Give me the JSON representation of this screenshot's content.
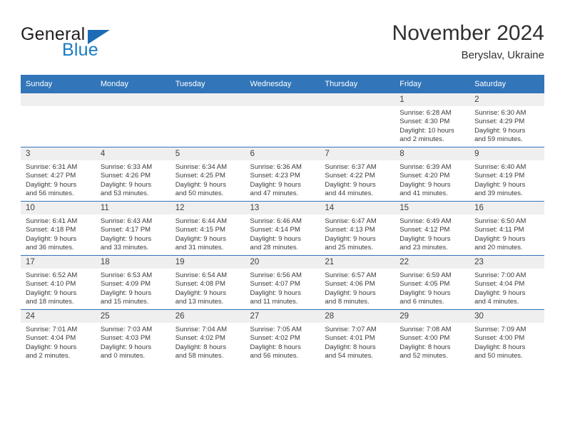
{
  "brand": {
    "name_part1": "General",
    "name_part2": "Blue",
    "logo_icon": "triangle-icon"
  },
  "header": {
    "month_year": "November 2024",
    "location": "Beryslav, Ukraine"
  },
  "calendar": {
    "weekday_headers": [
      "Sunday",
      "Monday",
      "Tuesday",
      "Wednesday",
      "Thursday",
      "Friday",
      "Saturday"
    ],
    "accent_color": "#3275b9",
    "daynum_band_color": "#efefef",
    "weeks": [
      [
        {
          "day": "",
          "empty": true
        },
        {
          "day": "",
          "empty": true
        },
        {
          "day": "",
          "empty": true
        },
        {
          "day": "",
          "empty": true
        },
        {
          "day": "",
          "empty": true
        },
        {
          "day": "1",
          "sunrise": "Sunrise: 6:28 AM",
          "sunset": "Sunset: 4:30 PM",
          "daylight1": "Daylight: 10 hours",
          "daylight2": "and 2 minutes."
        },
        {
          "day": "2",
          "sunrise": "Sunrise: 6:30 AM",
          "sunset": "Sunset: 4:29 PM",
          "daylight1": "Daylight: 9 hours",
          "daylight2": "and 59 minutes."
        }
      ],
      [
        {
          "day": "3",
          "sunrise": "Sunrise: 6:31 AM",
          "sunset": "Sunset: 4:27 PM",
          "daylight1": "Daylight: 9 hours",
          "daylight2": "and 56 minutes."
        },
        {
          "day": "4",
          "sunrise": "Sunrise: 6:33 AM",
          "sunset": "Sunset: 4:26 PM",
          "daylight1": "Daylight: 9 hours",
          "daylight2": "and 53 minutes."
        },
        {
          "day": "5",
          "sunrise": "Sunrise: 6:34 AM",
          "sunset": "Sunset: 4:25 PM",
          "daylight1": "Daylight: 9 hours",
          "daylight2": "and 50 minutes."
        },
        {
          "day": "6",
          "sunrise": "Sunrise: 6:36 AM",
          "sunset": "Sunset: 4:23 PM",
          "daylight1": "Daylight: 9 hours",
          "daylight2": "and 47 minutes."
        },
        {
          "day": "7",
          "sunrise": "Sunrise: 6:37 AM",
          "sunset": "Sunset: 4:22 PM",
          "daylight1": "Daylight: 9 hours",
          "daylight2": "and 44 minutes."
        },
        {
          "day": "8",
          "sunrise": "Sunrise: 6:39 AM",
          "sunset": "Sunset: 4:20 PM",
          "daylight1": "Daylight: 9 hours",
          "daylight2": "and 41 minutes."
        },
        {
          "day": "9",
          "sunrise": "Sunrise: 6:40 AM",
          "sunset": "Sunset: 4:19 PM",
          "daylight1": "Daylight: 9 hours",
          "daylight2": "and 39 minutes."
        }
      ],
      [
        {
          "day": "10",
          "sunrise": "Sunrise: 6:41 AM",
          "sunset": "Sunset: 4:18 PM",
          "daylight1": "Daylight: 9 hours",
          "daylight2": "and 36 minutes."
        },
        {
          "day": "11",
          "sunrise": "Sunrise: 6:43 AM",
          "sunset": "Sunset: 4:17 PM",
          "daylight1": "Daylight: 9 hours",
          "daylight2": "and 33 minutes."
        },
        {
          "day": "12",
          "sunrise": "Sunrise: 6:44 AM",
          "sunset": "Sunset: 4:15 PM",
          "daylight1": "Daylight: 9 hours",
          "daylight2": "and 31 minutes."
        },
        {
          "day": "13",
          "sunrise": "Sunrise: 6:46 AM",
          "sunset": "Sunset: 4:14 PM",
          "daylight1": "Daylight: 9 hours",
          "daylight2": "and 28 minutes."
        },
        {
          "day": "14",
          "sunrise": "Sunrise: 6:47 AM",
          "sunset": "Sunset: 4:13 PM",
          "daylight1": "Daylight: 9 hours",
          "daylight2": "and 25 minutes."
        },
        {
          "day": "15",
          "sunrise": "Sunrise: 6:49 AM",
          "sunset": "Sunset: 4:12 PM",
          "daylight1": "Daylight: 9 hours",
          "daylight2": "and 23 minutes."
        },
        {
          "day": "16",
          "sunrise": "Sunrise: 6:50 AM",
          "sunset": "Sunset: 4:11 PM",
          "daylight1": "Daylight: 9 hours",
          "daylight2": "and 20 minutes."
        }
      ],
      [
        {
          "day": "17",
          "sunrise": "Sunrise: 6:52 AM",
          "sunset": "Sunset: 4:10 PM",
          "daylight1": "Daylight: 9 hours",
          "daylight2": "and 18 minutes."
        },
        {
          "day": "18",
          "sunrise": "Sunrise: 6:53 AM",
          "sunset": "Sunset: 4:09 PM",
          "daylight1": "Daylight: 9 hours",
          "daylight2": "and 15 minutes."
        },
        {
          "day": "19",
          "sunrise": "Sunrise: 6:54 AM",
          "sunset": "Sunset: 4:08 PM",
          "daylight1": "Daylight: 9 hours",
          "daylight2": "and 13 minutes."
        },
        {
          "day": "20",
          "sunrise": "Sunrise: 6:56 AM",
          "sunset": "Sunset: 4:07 PM",
          "daylight1": "Daylight: 9 hours",
          "daylight2": "and 11 minutes."
        },
        {
          "day": "21",
          "sunrise": "Sunrise: 6:57 AM",
          "sunset": "Sunset: 4:06 PM",
          "daylight1": "Daylight: 9 hours",
          "daylight2": "and 8 minutes."
        },
        {
          "day": "22",
          "sunrise": "Sunrise: 6:59 AM",
          "sunset": "Sunset: 4:05 PM",
          "daylight1": "Daylight: 9 hours",
          "daylight2": "and 6 minutes."
        },
        {
          "day": "23",
          "sunrise": "Sunrise: 7:00 AM",
          "sunset": "Sunset: 4:04 PM",
          "daylight1": "Daylight: 9 hours",
          "daylight2": "and 4 minutes."
        }
      ],
      [
        {
          "day": "24",
          "sunrise": "Sunrise: 7:01 AM",
          "sunset": "Sunset: 4:04 PM",
          "daylight1": "Daylight: 9 hours",
          "daylight2": "and 2 minutes."
        },
        {
          "day": "25",
          "sunrise": "Sunrise: 7:03 AM",
          "sunset": "Sunset: 4:03 PM",
          "daylight1": "Daylight: 9 hours",
          "daylight2": "and 0 minutes."
        },
        {
          "day": "26",
          "sunrise": "Sunrise: 7:04 AM",
          "sunset": "Sunset: 4:02 PM",
          "daylight1": "Daylight: 8 hours",
          "daylight2": "and 58 minutes."
        },
        {
          "day": "27",
          "sunrise": "Sunrise: 7:05 AM",
          "sunset": "Sunset: 4:02 PM",
          "daylight1": "Daylight: 8 hours",
          "daylight2": "and 56 minutes."
        },
        {
          "day": "28",
          "sunrise": "Sunrise: 7:07 AM",
          "sunset": "Sunset: 4:01 PM",
          "daylight1": "Daylight: 8 hours",
          "daylight2": "and 54 minutes."
        },
        {
          "day": "29",
          "sunrise": "Sunrise: 7:08 AM",
          "sunset": "Sunset: 4:00 PM",
          "daylight1": "Daylight: 8 hours",
          "daylight2": "and 52 minutes."
        },
        {
          "day": "30",
          "sunrise": "Sunrise: 7:09 AM",
          "sunset": "Sunset: 4:00 PM",
          "daylight1": "Daylight: 8 hours",
          "daylight2": "and 50 minutes."
        }
      ]
    ]
  }
}
